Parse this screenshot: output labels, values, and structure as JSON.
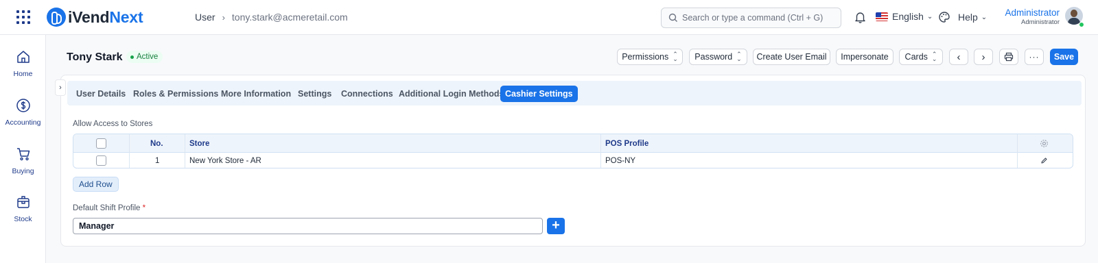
{
  "brand": {
    "name_part1": "iVend",
    "name_part2": "Next",
    "accent": "#1a73e8"
  },
  "breadcrumb": {
    "root": "User",
    "current": "tony.stark@acmeretail.com"
  },
  "search": {
    "placeholder": "Search or type a command (Ctrl + G)"
  },
  "header": {
    "language": "English",
    "help": "Help",
    "user_name": "Administrator",
    "user_role": "Administrator"
  },
  "sidebar": {
    "items": [
      {
        "label": "Home",
        "icon": "home-icon"
      },
      {
        "label": "Accounting",
        "icon": "dollar-icon"
      },
      {
        "label": "Buying",
        "icon": "cart-icon"
      },
      {
        "label": "Stock",
        "icon": "box-icon"
      }
    ]
  },
  "page": {
    "title": "Tony Stark",
    "status": "Active",
    "status_color": "#15803d"
  },
  "toolbar": {
    "permissions": "Permissions",
    "password": "Password",
    "create_user_email": "Create User Email",
    "impersonate": "Impersonate",
    "cards": "Cards",
    "save": "Save"
  },
  "tabs": [
    {
      "label": "User Details",
      "active": false
    },
    {
      "label": "Roles & Permissions",
      "active": false
    },
    {
      "label": "More Information",
      "active": false
    },
    {
      "label": "Settings",
      "active": false
    },
    {
      "label": "Connections",
      "active": false
    },
    {
      "label": "Additional Login Methods",
      "active": false
    },
    {
      "label": "Cashier Settings",
      "active": true
    }
  ],
  "stores_table": {
    "label": "Allow Access to Stores",
    "columns": [
      "No.",
      "Store",
      "POS Profile"
    ],
    "rows": [
      {
        "no": "1",
        "store": "New York Store - AR",
        "pos_profile": "POS-NY"
      }
    ],
    "add_row": "Add Row"
  },
  "shift_profile": {
    "label": "Default Shift Profile",
    "required_mark": "*",
    "value": "Manager"
  }
}
